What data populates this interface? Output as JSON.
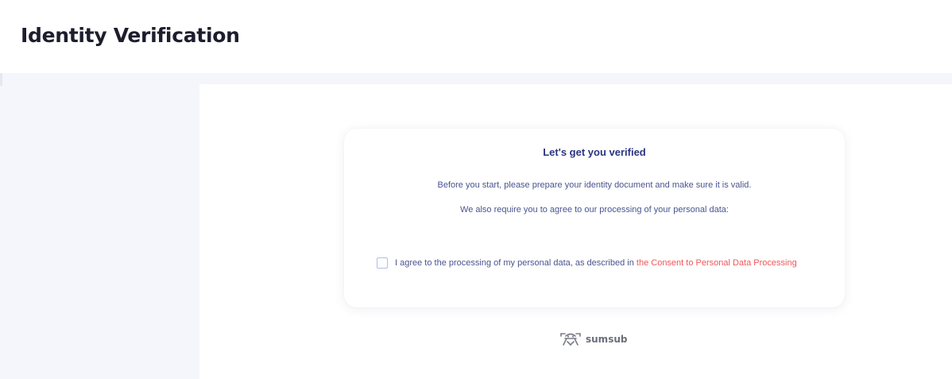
{
  "header": {
    "title": "Identity Verification"
  },
  "card": {
    "title": "Let's get you verified",
    "intro": "Before you start, please prepare your identity document and make sure it is valid.",
    "requirement": "We also require you to agree to our processing of your personal data:",
    "consent": {
      "checked": false,
      "text": "I agree to the processing of my personal data, as described in ",
      "link_text": "the Consent to Personal Data Processing"
    }
  },
  "footer": {
    "brand_name": "sumsub",
    "brand_icon": "sumsub-logo-icon"
  },
  "colors": {
    "title_text": "#1d1d2e",
    "card_title": "#2a3480",
    "body_text": "#4a5490",
    "link": "#f0565a",
    "checkbox_border": "#b4bbe6",
    "panel_background": "#f4f6fb",
    "brand_gray": "#6b6e7a"
  }
}
